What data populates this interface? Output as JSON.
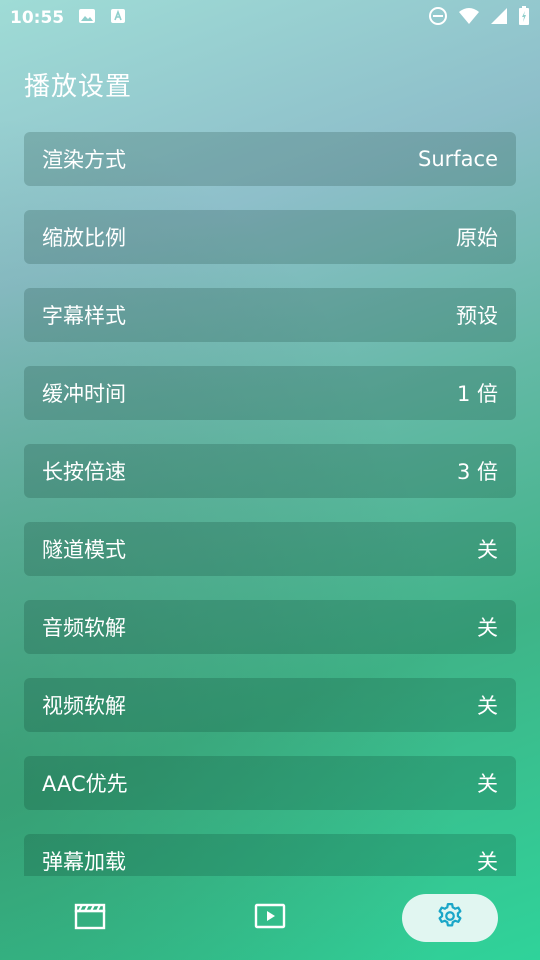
{
  "status_bar": {
    "time": "10:55",
    "icons_left": [
      "image-icon",
      "a-text-icon"
    ],
    "icons_right": [
      "dnd-icon",
      "wifi-icon",
      "signal-icon",
      "battery-icon"
    ]
  },
  "page": {
    "title": "播放设置"
  },
  "settings": [
    {
      "label": "渲染方式",
      "value": "Surface"
    },
    {
      "label": "缩放比例",
      "value": "原始"
    },
    {
      "label": "字幕样式",
      "value": "预设"
    },
    {
      "label": "缓冲时间",
      "value": "1 倍"
    },
    {
      "label": "长按倍速",
      "value": "3 倍"
    },
    {
      "label": "隧道模式",
      "value": "关"
    },
    {
      "label": "音频软解",
      "value": "关"
    },
    {
      "label": "视频软解",
      "value": "关"
    },
    {
      "label": "AAC优先",
      "value": "关"
    },
    {
      "label": "弹幕加载",
      "value": "关"
    }
  ],
  "bottom_nav": {
    "items": [
      {
        "icon": "clapperboard-icon",
        "active": false
      },
      {
        "icon": "play-icon",
        "active": false
      },
      {
        "icon": "gear-icon",
        "active": true
      }
    ]
  },
  "colors": {
    "active_icon": "#1aa6c8",
    "text": "#ffffff"
  }
}
